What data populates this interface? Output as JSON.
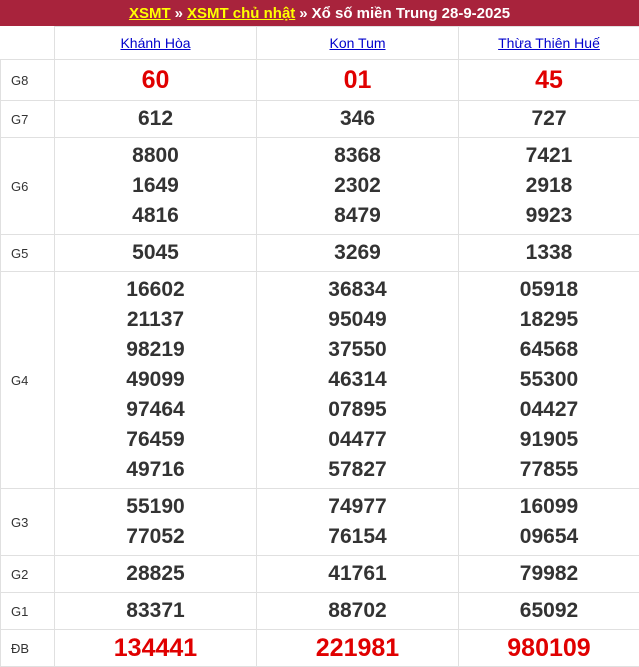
{
  "header": {
    "link_xsmt": "XSMT",
    "sep1": "»",
    "link_sunday": "XSMT chủ nhật",
    "sep2": "»",
    "title": "Xổ số miền Trung 28-9-2025"
  },
  "provinces": [
    "Khánh Hòa",
    "Kon Tum",
    "Thừa Thiên Huế"
  ],
  "prizes": [
    {
      "label": "G8",
      "values": [
        [
          "60"
        ],
        [
          "01"
        ],
        [
          "45"
        ]
      ]
    },
    {
      "label": "G7",
      "values": [
        [
          "612"
        ],
        [
          "346"
        ],
        [
          "727"
        ]
      ]
    },
    {
      "label": "G6",
      "values": [
        [
          "8800",
          "1649",
          "4816"
        ],
        [
          "8368",
          "2302",
          "8479"
        ],
        [
          "7421",
          "2918",
          "9923"
        ]
      ]
    },
    {
      "label": "G5",
      "values": [
        [
          "5045"
        ],
        [
          "3269"
        ],
        [
          "1338"
        ]
      ]
    },
    {
      "label": "G4",
      "values": [
        [
          "16602",
          "21137",
          "98219",
          "49099",
          "97464",
          "76459",
          "49716"
        ],
        [
          "36834",
          "95049",
          "37550",
          "46314",
          "07895",
          "04477",
          "57827"
        ],
        [
          "05918",
          "18295",
          "64568",
          "55300",
          "04427",
          "91905",
          "77855"
        ]
      ]
    },
    {
      "label": "G3",
      "values": [
        [
          "55190",
          "77052"
        ],
        [
          "74977",
          "76154"
        ],
        [
          "16099",
          "09654"
        ]
      ]
    },
    {
      "label": "G2",
      "values": [
        [
          "28825"
        ],
        [
          "41761"
        ],
        [
          "79982"
        ]
      ]
    },
    {
      "label": "G1",
      "values": [
        [
          "83371"
        ],
        [
          "88702"
        ],
        [
          "65092"
        ]
      ]
    },
    {
      "label": "ĐB",
      "values": [
        [
          "134441"
        ],
        [
          "221981"
        ],
        [
          "980109"
        ]
      ]
    }
  ],
  "colors": {
    "header_bg": "#a8233c",
    "header_link": "#ffff00",
    "special_red": "#e00000",
    "province_link": "#0000cc"
  }
}
